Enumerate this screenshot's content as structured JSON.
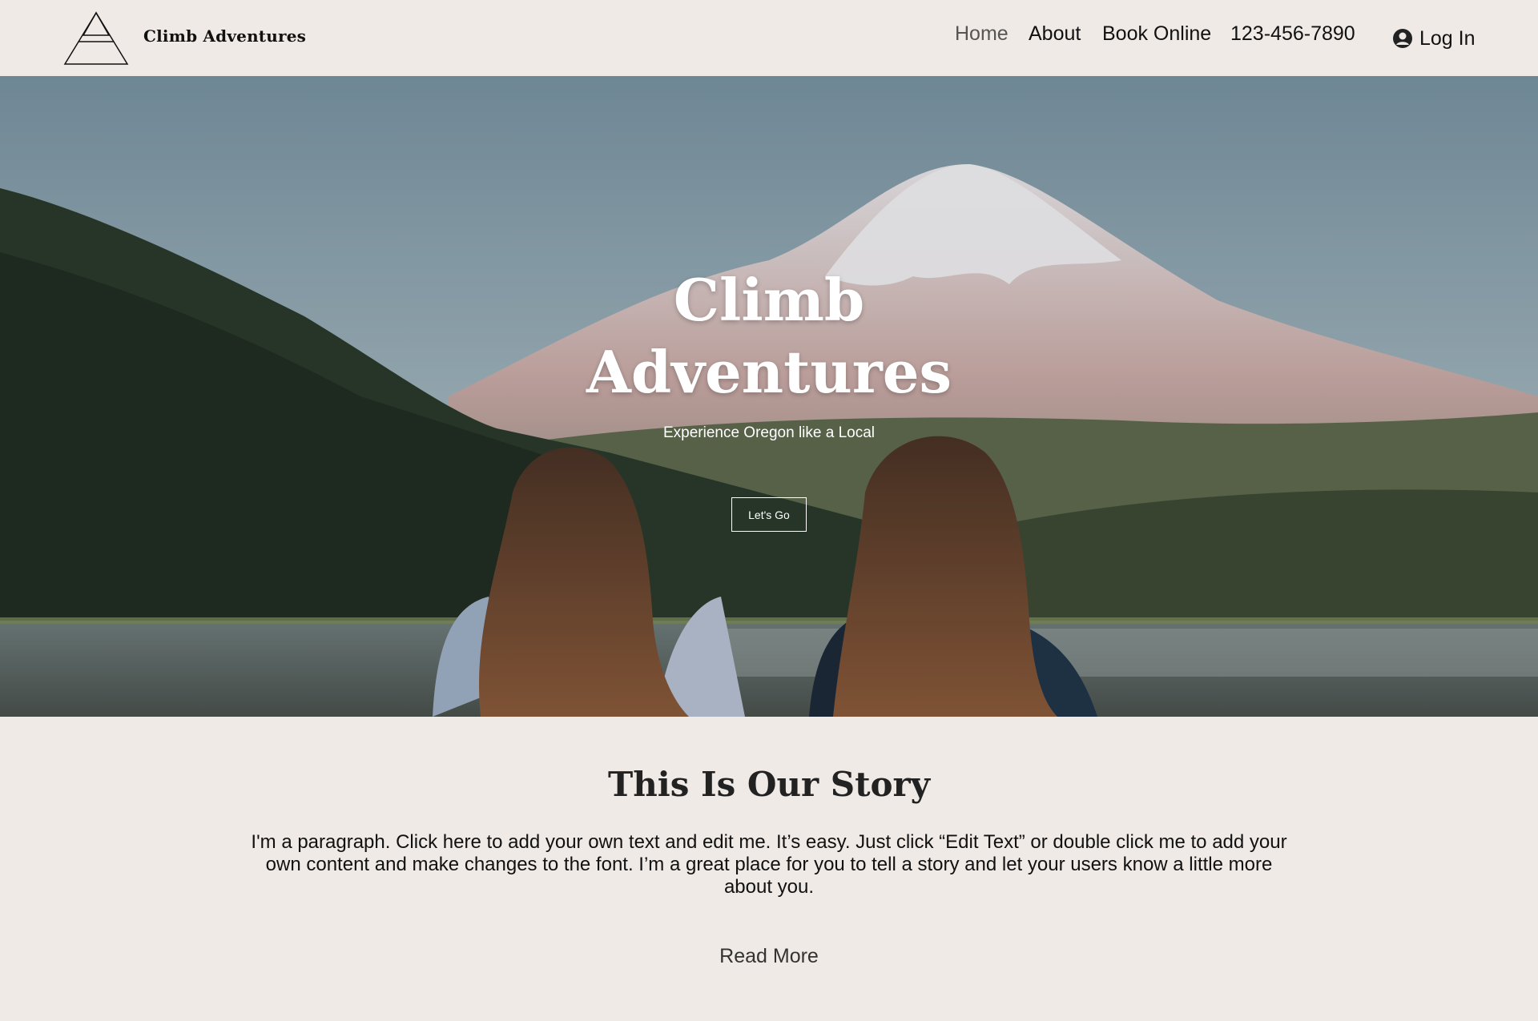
{
  "header": {
    "brand": "Climb Adventures",
    "nav": {
      "home": "Home",
      "about": "About",
      "book": "Book Online",
      "phone": "123-456-7890"
    },
    "login": "Log In",
    "login_icon": "user-avatar-icon",
    "logo_icon": "triangle-mountain-icon"
  },
  "hero": {
    "title_line1": "Climb",
    "title_line2": "Adventures",
    "subtitle": "Experience Oregon like a Local",
    "button": "Let's Go"
  },
  "story": {
    "title": "This Is Our Story",
    "paragraph": "I'm a paragraph. Click here to add your own text and edit me. It’s easy. Just click “Edit Text” or double click me to add your own content and make changes to the font. I’m a great place for you to tell a story and let your users know a little more about you.",
    "read_more": "Read More"
  },
  "colors": {
    "page_bg": "#efeae6",
    "text": "#111111",
    "nav_active": "#555555",
    "hero_text": "#ffffff"
  }
}
